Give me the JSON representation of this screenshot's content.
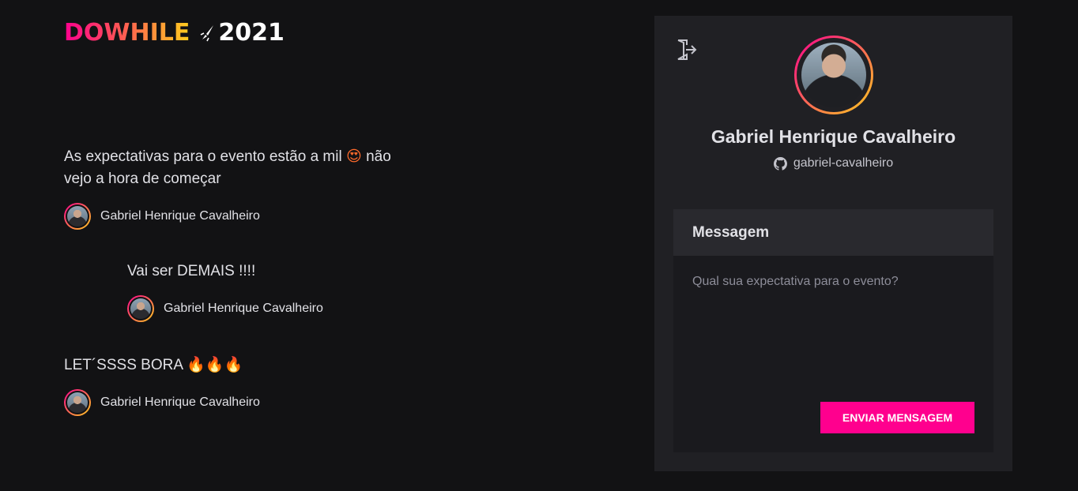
{
  "logo": {
    "word": "DOWHILE",
    "year": "2021"
  },
  "messages": [
    {
      "text": "As expectativas para o evento estão a mil",
      "emoji": "😍",
      "text_after": "não vejo a hora de começar",
      "author": "Gabriel Henrique Cavalheiro"
    },
    {
      "text": "Vai ser DEMAIS !!!!",
      "author": "Gabriel Henrique Cavalheiro"
    },
    {
      "text": "LET´SSSS BORA",
      "emoji": "🔥🔥🔥",
      "author": "Gabriel Henrique Cavalheiro"
    }
  ],
  "profile": {
    "name": "Gabriel Henrique Cavalheiro",
    "github": "gabriel-cavalheiro",
    "signout_icon": "sign-out-icon",
    "github_icon": "github-icon"
  },
  "form": {
    "title": "Messagem",
    "placeholder": "Qual sua expectativa para o evento?",
    "submit_label": "ENVIAR MENSAGEM"
  },
  "colors": {
    "background": "#121214",
    "panel": "#202024",
    "accent_pink": "#ff008e",
    "accent_yellow": "#ffcd1e"
  }
}
